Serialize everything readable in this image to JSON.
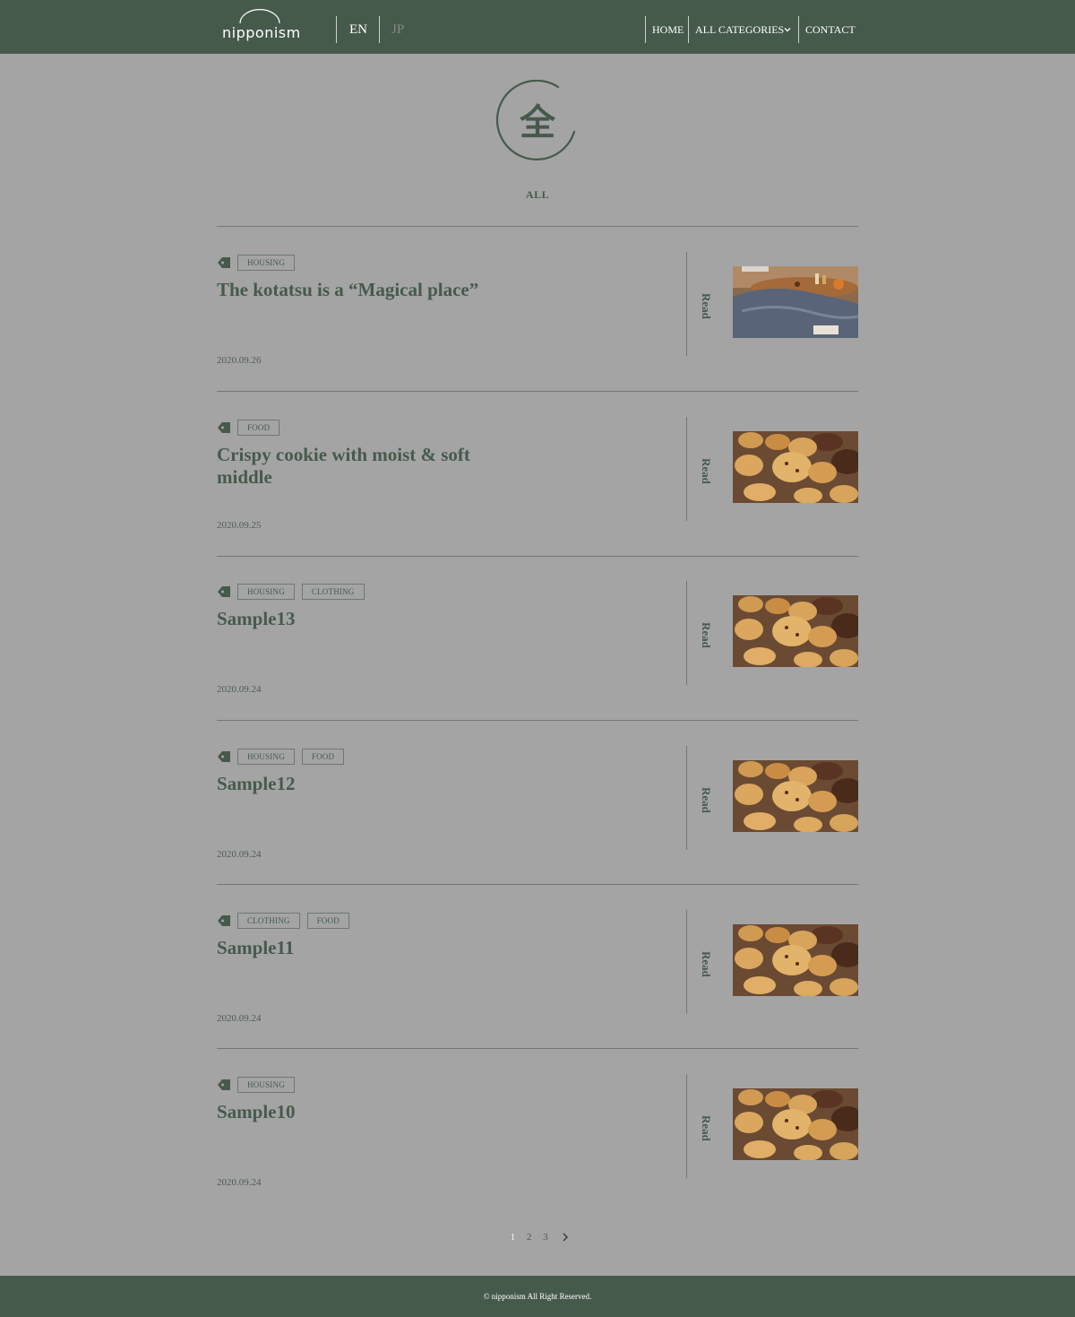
{
  "header": {
    "logo_text": "nipponism",
    "lang_en": "EN",
    "lang_jp": "JP",
    "nav": {
      "home": "HOME",
      "categories": "ALL CATEGORIES",
      "contact": "CONTACT"
    }
  },
  "hero": {
    "emblem_char": "全",
    "label": "ALL"
  },
  "posts": [
    {
      "tags": [
        "HOUSING"
      ],
      "title": "The kotatsu is a “Magical place”",
      "date": "2020.09.26",
      "read": "Read",
      "thumb": "kotatsu"
    },
    {
      "tags": [
        "FOOD"
      ],
      "title": "Crispy cookie with moist & soft middle",
      "date": "2020.09.25",
      "read": "Read",
      "thumb": "cookies"
    },
    {
      "tags": [
        "HOUSING",
        "CLOTHING"
      ],
      "title": "Sample13",
      "date": "2020.09.24",
      "read": "Read",
      "thumb": "cookies"
    },
    {
      "tags": [
        "HOUSING",
        "FOOD"
      ],
      "title": "Sample12",
      "date": "2020.09.24",
      "read": "Read",
      "thumb": "cookies"
    },
    {
      "tags": [
        "CLOTHING",
        "FOOD"
      ],
      "title": "Sample11",
      "date": "2020.09.24",
      "read": "Read",
      "thumb": "cookies"
    },
    {
      "tags": [
        "HOUSING"
      ],
      "title": "Sample10",
      "date": "2020.09.24",
      "read": "Read",
      "thumb": "cookies"
    }
  ],
  "pagination": {
    "pages": [
      "1",
      "2",
      "3"
    ],
    "current": "1"
  },
  "footer": {
    "copyright": "© nipponism All Right Reserved."
  },
  "colors": {
    "header_bg": "#465a4c",
    "page_bg": "#a4a4a4",
    "accent": "#465a4c"
  }
}
